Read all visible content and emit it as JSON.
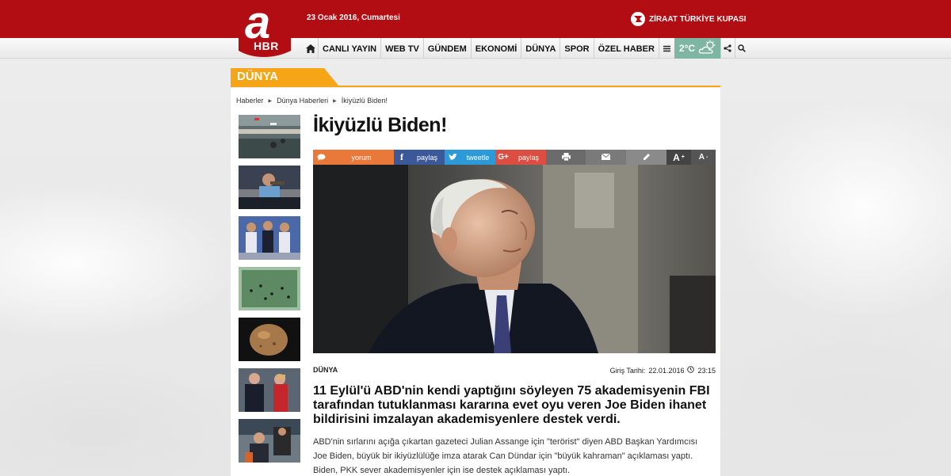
{
  "header": {
    "date": "23 Ocak 2016, Cumartesi",
    "cup_link": "ZİRAAT TÜRKİYE KUPASI",
    "logo_text": "HBR",
    "brand_red": "#b30d14"
  },
  "nav": {
    "items": [
      "CANLI YAYIN",
      "WEB TV",
      "GÜNDEM",
      "EKONOMİ",
      "DÜNYA",
      "SPOR",
      "ÖZEL HABER"
    ],
    "weather": "2°C"
  },
  "section": {
    "title": "DÜNYA",
    "accent": "#f5a515"
  },
  "breadcrumb": [
    "Haberler",
    "Dünya Haberleri",
    "İkiyüzlü Biden!"
  ],
  "article": {
    "headline": "İkiyüzlü Biden!",
    "category": "DÜNYA",
    "date_label": "Giriş Tarihi:",
    "date": "22.01.2016",
    "time": "23:15",
    "lead": "11 Eylül'ü ABD'nin kendi yaptığını söyleyen 75 akademisyenin FBI tarafından tutuklanması kararına evet oyu veren Joe Biden ihanet bildirisini imzalayan akademisyenlere destek verdi.",
    "body": "ABD'nin sırlarını açığa çıkartan gazeteci Julian Assange için \"terörist\" diyen ABD Başkan Yardımcısı Joe Biden, büyük bir ikiyüzlülüğe imza atarak Can Dündar için \"büyük kahraman\" açıklaması yaptı. Biden, PKK sever akademisyenler için ise destek açıklaması yaptı."
  },
  "share": {
    "comment": "yorum",
    "facebook": "paylaş",
    "twitter": "tweetle",
    "google": "paylaş",
    "font_up": "A",
    "font_down": "A",
    "comment_color": "#e8793a",
    "facebook_color": "#3b5998",
    "twitter_color": "#2d9ad8",
    "google_color": "#dc4e41",
    "tools_color": "#666666"
  }
}
